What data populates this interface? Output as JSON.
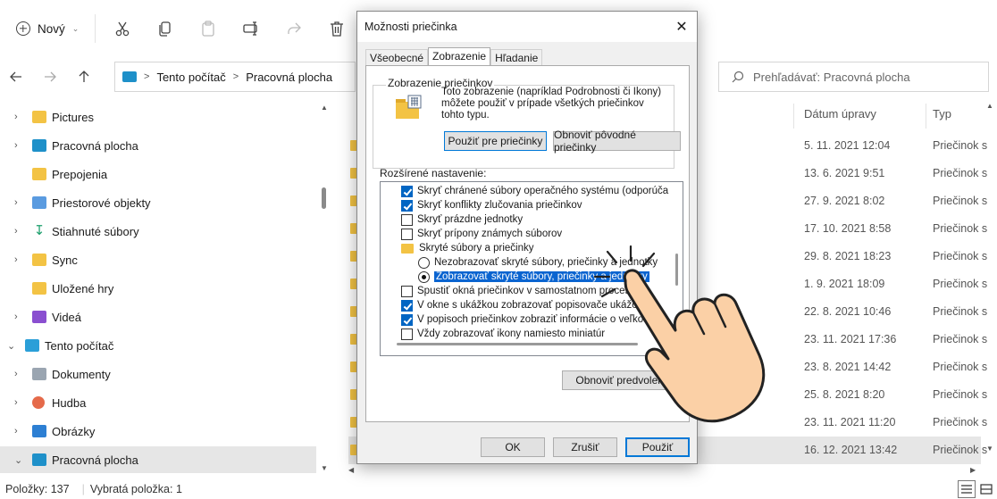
{
  "toolbar": {
    "new_label": "Nový"
  },
  "address": {
    "crumbs": [
      "Tento počítač",
      "Pracovná plocha"
    ],
    "search_placeholder": "Prehľadávať: Pracovná plocha"
  },
  "sidebar": {
    "items": [
      {
        "label": "Pictures",
        "icon": "folder-icon"
      },
      {
        "label": "Pracovná plocha",
        "icon": "desktop-icon"
      },
      {
        "label": "Prepojenia",
        "icon": "folder-icon"
      },
      {
        "label": "Priestorové objekty",
        "icon": "3d-objects-icon"
      },
      {
        "label": "Stiahnuté súbory",
        "icon": "download-icon"
      },
      {
        "label": "Sync",
        "icon": "folder-icon"
      },
      {
        "label": "Uložené hry",
        "icon": "folder-icon"
      },
      {
        "label": "Videá",
        "icon": "videos-icon"
      },
      {
        "label": "Tento počítač",
        "icon": "this-pc-icon"
      },
      {
        "label": "Dokumenty",
        "icon": "documents-icon"
      },
      {
        "label": "Hudba",
        "icon": "music-icon"
      },
      {
        "label": "Obrázky",
        "icon": "pictures-icon"
      },
      {
        "label": "Pracovná plocha",
        "icon": "desktop-icon"
      }
    ]
  },
  "files": {
    "columns": {
      "date": "Dátum úpravy",
      "type": "Typ"
    },
    "rows": [
      {
        "date": "5. 11. 2021 12:04",
        "type": "Priečinok s"
      },
      {
        "date": "13. 6. 2021 9:51",
        "type": "Priečinok s"
      },
      {
        "date": "27. 9. 2021 8:02",
        "type": "Priečinok s"
      },
      {
        "date": "17. 10. 2021 8:58",
        "type": "Priečinok s"
      },
      {
        "date": "29. 8. 2021 18:23",
        "type": "Priečinok s"
      },
      {
        "date": "1. 9. 2021 18:09",
        "type": "Priečinok s"
      },
      {
        "date": "22. 8. 2021 10:46",
        "type": "Priečinok s"
      },
      {
        "date": "23. 11. 2021 17:36",
        "type": "Priečinok s"
      },
      {
        "date": "23. 8. 2021 14:42",
        "type": "Priečinok s"
      },
      {
        "date": "25. 8. 2021 8:20",
        "type": "Priečinok s"
      },
      {
        "date": "23. 11. 2021 11:20",
        "type": "Priečinok s"
      },
      {
        "date": "16. 12. 2021 13:42",
        "type": "Priečinok s"
      }
    ]
  },
  "status": {
    "items_count": "Položky: 137",
    "selected": "Vybratá položka: 1"
  },
  "dialog": {
    "title": "Možnosti priečinka",
    "tabs": [
      "Všeobecné",
      "Zobrazenie",
      "Hľadanie"
    ],
    "group_title": "Zobrazenie priečinkov",
    "group_desc": "Toto zobrazenie (napríklad Podrobnosti či Ikony) môžete použiť v prípade všetkých priečinkov tohto typu.",
    "apply_to_folders": "Použiť pre priečinky",
    "reset_folders": "Obnoviť pôvodné priečinky",
    "advanced_label": "Rozšírené nastavenie:",
    "settings": [
      {
        "label": "Skryť chránené súbory operačného systému (odporúča sa)",
        "kind": "checkbox",
        "checked": true
      },
      {
        "label": "Skryť konflikty zlučovania priečinkov",
        "kind": "checkbox",
        "checked": true
      },
      {
        "label": "Skryť prázdne jednotky",
        "kind": "checkbox",
        "checked": false
      },
      {
        "label": "Skryť prípony známych súborov",
        "kind": "checkbox",
        "checked": false
      },
      {
        "label": "Skryté súbory a priečinky",
        "kind": "folder"
      },
      {
        "label": "Nezobrazovať skryté súbory, priečinky a jednotky",
        "kind": "radio",
        "checked": false
      },
      {
        "label": "Zobrazovať skryté súbory, priečinky a jednotky",
        "kind": "radio",
        "checked": true
      },
      {
        "label": "Spustiť okná priečinkov v samostatnom procese",
        "kind": "checkbox",
        "checked": false
      },
      {
        "label": "V okne s ukážkou zobrazovať popisovače ukážok",
        "kind": "checkbox",
        "checked": true
      },
      {
        "label": "V popisoch priečinkov zobraziť informácie o veľkosti s",
        "kind": "checkbox",
        "checked": true
      },
      {
        "label": "Vždy zobrazovať ikony namiesto miniatúr",
        "kind": "checkbox",
        "checked": false
      }
    ],
    "restore_defaults": "Obnoviť predvolené",
    "ok": "OK",
    "cancel": "Zrušiť",
    "apply": "Použiť"
  }
}
